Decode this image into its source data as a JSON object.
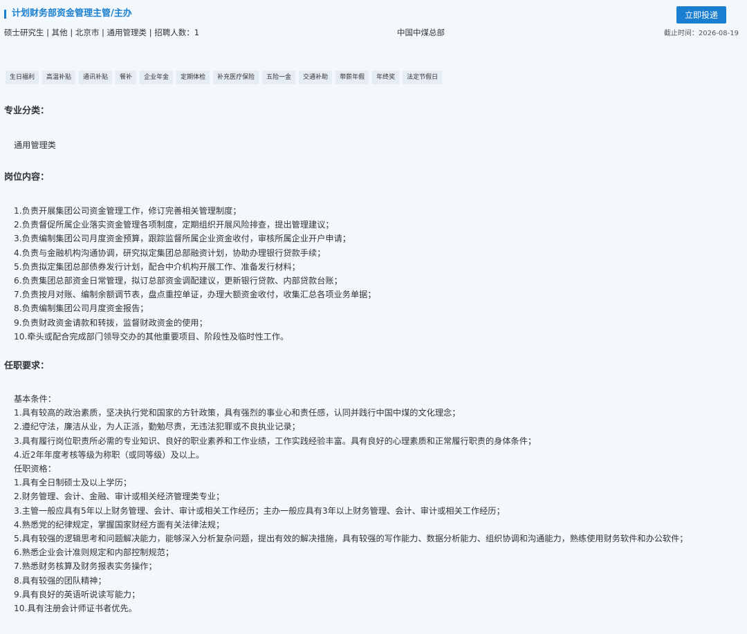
{
  "job": {
    "title": "计划财务部资金管理主管/主办",
    "apply_label": "立即投递",
    "meta": "硕士研究生 | 其他 | 北京市 |  通用管理类 | 招聘人数：1",
    "company": "中国中煤总部",
    "deadline": "截止时间：2026-08-19"
  },
  "tags": [
    "生日福利",
    "高温补贴",
    "通讯补贴",
    "餐补",
    "企业年金",
    "定期体检",
    "补充医疗保险",
    "五险一金",
    "交通补助",
    "带薪年假",
    "年终奖",
    "法定节假日"
  ],
  "sections": {
    "category": {
      "title": "专业分类：",
      "content": "通用管理类"
    },
    "duties": {
      "title": "岗位内容：",
      "lines": [
        "1.负责开展集团公司资金管理工作，修订完善相关管理制度；",
        "2.负责督促所属企业落实资金管理各项制度，定期组织开展风险排查，提出管理建议；",
        "3.负责编制集团公司月度资金预算，跟踪监督所属企业资金收付，审核所属企业开户申请；",
        "4.负责与金融机构沟通协调，研究拟定集团总部融资计划，协助办理银行贷款手续；",
        "5.负责拟定集团总部债券发行计划，配合中介机构开展工作、准备发行材料；",
        "6.负责集团总部资金日常管理，拟订总部资金调配建议，更新银行贷款、内部贷款台账；",
        "7.负责按月对账、编制余额调节表，盘点重控单证，办理大额资金收付，收集汇总各项业务单据；",
        "8.负责编制集团公司月度资金报告；",
        "9.负责财政资金请款和转拨，监督财政资金的使用；",
        "10.牵头或配合完成部门领导交办的其他重要项目、阶段性及临时性工作。"
      ]
    },
    "requirements": {
      "title": "任职要求：",
      "lines": [
        "基本条件：",
        "1.具有较高的政治素质，坚决执行党和国家的方针政策，具有强烈的事业心和责任感，认同并践行中国中煤的文化理念；",
        "2.遵纪守法，廉洁从业，为人正派，勤勉尽责，无违法犯罪或不良执业记录；",
        "3.具有履行岗位职责所必需的专业知识、良好的职业素养和工作业绩，工作实践经验丰富。具有良好的心理素质和正常履行职责的身体条件；",
        "4.近2年年度考核等级为称职（或同等级）及以上。",
        "任职资格：",
        "1.具有全日制硕士及以上学历；",
        "2.财务管理、会计、金融、审计或相关经济管理类专业；",
        "3.主管一般应具有5年以上财务管理、会计、审计或相关工作经历；主办一般应具有3年以上财务管理、会计、审计或相关工作经历；",
        "4.熟悉党的纪律规定，掌握国家财经方面有关法律法规；",
        "5.具有较强的逻辑思考和问题解决能力，能够深入分析复杂问题，提出有效的解决措施，具有较强的写作能力、数据分析能力、组织协调和沟通能力，熟练使用财务软件和办公软件；",
        "6.熟悉企业会计准则规定和内部控制规范；",
        "7.熟悉财务核算及财务报表实务操作；",
        "8.具有较强的团队精神；",
        "9.具有良好的英语听说读写能力；",
        "10.具有注册会计师证书者优先。"
      ]
    }
  }
}
